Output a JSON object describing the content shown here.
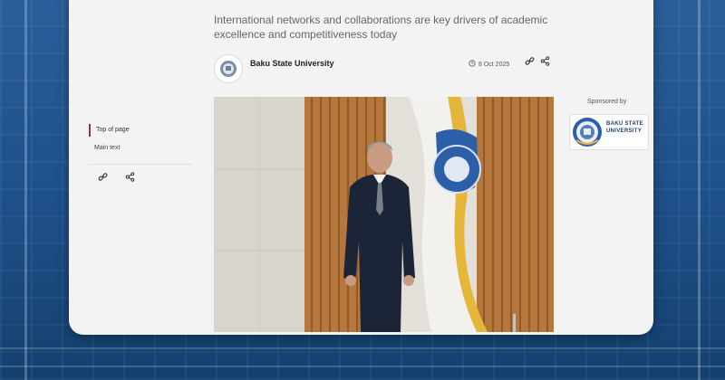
{
  "article": {
    "subtitle": "International networks and collaborations are key drivers of academic excellence and competitiveness today",
    "author": "Baku State University",
    "date": "8 Oct 2025"
  },
  "toc": {
    "items": [
      "Top of page",
      "Main text"
    ]
  },
  "sponsor": {
    "label": "Sponsored by",
    "name": "BAKU STATE UNIVERSITY"
  },
  "icons": {
    "clock": "clock-icon",
    "link": "link-icon",
    "share": "share-icon"
  },
  "colors": {
    "background": "#1f4f86",
    "card": "#f3f3f3",
    "toc_accent": "#a0286b",
    "sponsor_text": "#1f3f6b"
  }
}
